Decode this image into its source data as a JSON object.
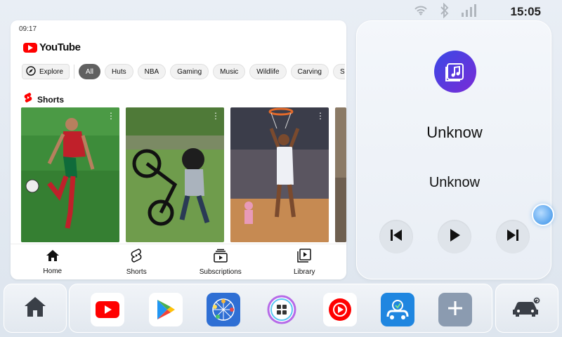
{
  "status_bar": {
    "time": "15:05",
    "icons": [
      "wifi-icon",
      "bluetooth-icon",
      "signal-icon"
    ]
  },
  "youtube": {
    "time": "09:17",
    "logo_text": "YouTube",
    "explore_label": "Explore",
    "chips": [
      "All",
      "Huts",
      "NBA",
      "Gaming",
      "Music",
      "Wildlife",
      "Carving",
      "Sci-"
    ],
    "active_chip": "All",
    "shorts_label": "Shorts",
    "shorts": [
      {
        "name": "soccer-short"
      },
      {
        "name": "bike-short"
      },
      {
        "name": "basketball-short"
      },
      {
        "name": "partial-short"
      }
    ],
    "nav": {
      "home": "Home",
      "shorts": "Shorts",
      "subscriptions": "Subscriptions",
      "library": "Library"
    }
  },
  "music": {
    "title": "Unknow",
    "artist": "Unknow",
    "accent": "#4a3fe0"
  },
  "dock": {
    "apps": [
      "youtube-app",
      "google-play-app",
      "network-app",
      "launcher-app",
      "youtube-music-app",
      "car-connect-app",
      "add-app"
    ]
  }
}
